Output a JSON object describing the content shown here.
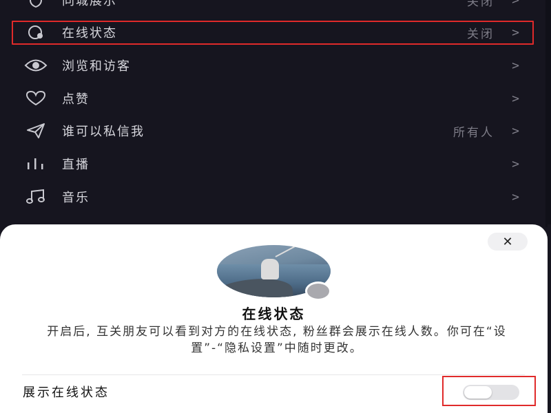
{
  "settings": {
    "rows": [
      {
        "label": "同城展示",
        "value": "关闭",
        "icon": "shield-icon"
      },
      {
        "label": "在线状态",
        "value": "关闭",
        "icon": "online-status-icon"
      },
      {
        "label": "浏览和访客",
        "value": "",
        "icon": "eye-icon"
      },
      {
        "label": "点赞",
        "value": "",
        "icon": "heart-icon"
      },
      {
        "label": "谁可以私信我",
        "value": "所有人",
        "icon": "send-icon"
      },
      {
        "label": "直播",
        "value": "",
        "icon": "live-bars-icon"
      },
      {
        "label": "音乐",
        "value": "",
        "icon": "music-note-icon"
      }
    ],
    "chevron": ">"
  },
  "sheet": {
    "close_glyph": "✕",
    "title": "在线状态",
    "description": "开启后, 互关朋友可以看到对方的在线状态, 粉丝群会展示在线人数。你可在“设置”-“隐私设置”中随时更改。",
    "toggle_label": "展示在线状态",
    "toggle_state": false
  },
  "colors": {
    "background": "#16151f",
    "highlight": "#e02a2a",
    "sheet_background": "#ffffff"
  }
}
